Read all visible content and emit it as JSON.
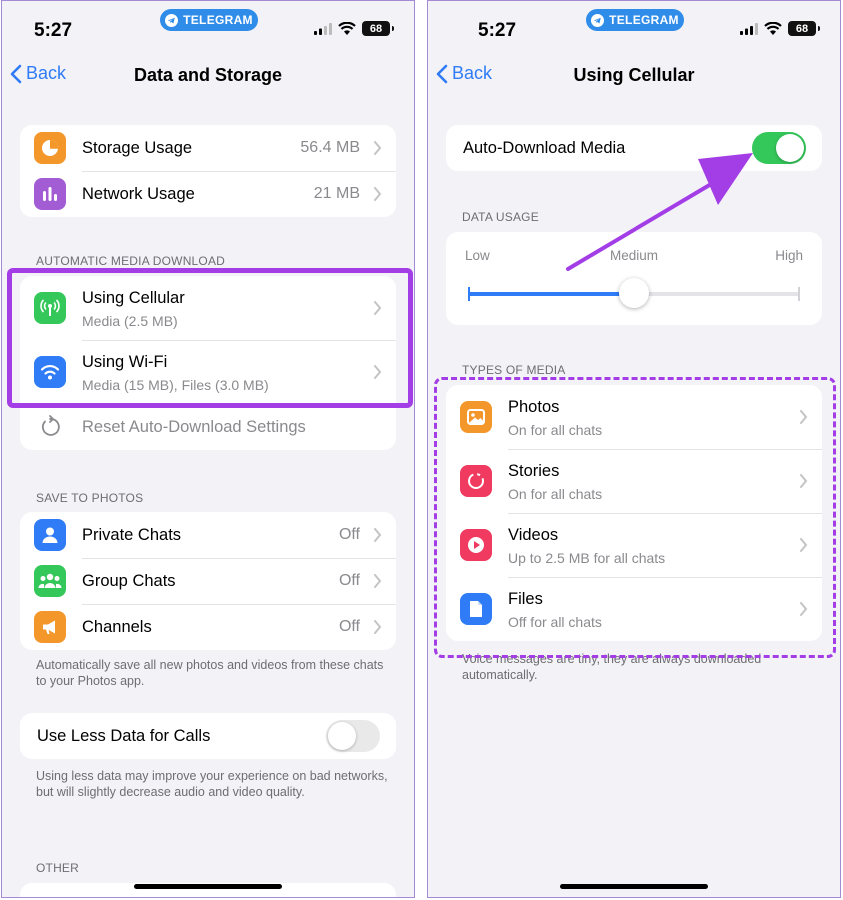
{
  "left": {
    "status": {
      "time": "5:27",
      "app_pill": "TELEGRAM",
      "battery": "68"
    },
    "nav": {
      "back": "Back",
      "title": "Data and Storage"
    },
    "storage_rows": [
      {
        "label": "Storage Usage",
        "value": "56.4 MB",
        "icon": "pie-chart-icon",
        "color": "#f4972a"
      },
      {
        "label": "Network Usage",
        "value": "21 MB",
        "icon": "bar-chart-icon",
        "color": "#a25dd5"
      }
    ],
    "auto_download": {
      "header": "AUTOMATIC MEDIA DOWNLOAD",
      "cellular": {
        "label": "Using Cellular",
        "sub": "Media (2.5 MB)"
      },
      "wifi": {
        "label": "Using Wi-Fi",
        "sub": "Media (15 MB), Files (3.0 MB)"
      },
      "reset": "Reset Auto-Download Settings"
    },
    "save_to_photos": {
      "header": "SAVE TO PHOTOS",
      "rows": [
        {
          "label": "Private Chats",
          "value": "Off"
        },
        {
          "label": "Group Chats",
          "value": "Off"
        },
        {
          "label": "Channels",
          "value": "Off"
        }
      ],
      "footnote": "Automatically save all new photos and videos from these chats to your Photos app."
    },
    "calls": {
      "label": "Use Less Data for Calls",
      "enabled": false,
      "footnote": "Using less data may improve your experience on bad networks, but will slightly decrease audio and video quality."
    },
    "other": {
      "header": "OTHER"
    }
  },
  "right": {
    "status": {
      "time": "5:27",
      "app_pill": "TELEGRAM",
      "battery": "68"
    },
    "nav": {
      "back": "Back",
      "title": "Using Cellular"
    },
    "auto_download_media": {
      "label": "Auto-Download Media",
      "enabled": true
    },
    "data_usage": {
      "header": "DATA USAGE",
      "low": "Low",
      "medium": "Medium",
      "high": "High",
      "level": 0.5
    },
    "types_of_media": {
      "header": "TYPES OF MEDIA",
      "rows": [
        {
          "label": "Photos",
          "sub": "On for all chats",
          "color": "#f4972a"
        },
        {
          "label": "Stories",
          "sub": "On for all chats",
          "color": "#f03a5f"
        },
        {
          "label": "Videos",
          "sub": "Up to 2.5 MB for all chats",
          "color": "#f03a5f"
        },
        {
          "label": "Files",
          "sub": "Off for all chats",
          "color": "#2f7cf6"
        }
      ],
      "footnote": "Voice messages are tiny, they are always downloaded automatically."
    }
  },
  "colors": {
    "accent": "#2f7cf6",
    "toggle_on": "#34c759",
    "highlight": "#a33de6"
  }
}
